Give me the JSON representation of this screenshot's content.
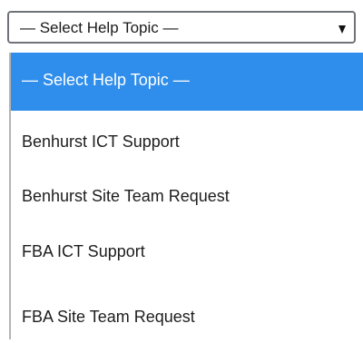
{
  "select": {
    "value": "— Select Help Topic —",
    "arrow_icon": "triangle-down-icon"
  },
  "dropdown": {
    "options": [
      {
        "label": "— Select Help Topic —",
        "highlighted": true
      },
      {
        "label": "Benhurst ICT Support",
        "highlighted": false
      },
      {
        "label": "Benhurst Site Team Request",
        "highlighted": false
      },
      {
        "label": "FBA ICT Support",
        "highlighted": false
      },
      {
        "label": "FBA Site Team Request",
        "highlighted": false
      }
    ]
  },
  "colors": {
    "highlight": "#2f8eeb",
    "text": "#1d1d1d",
    "border": "#6f7378"
  }
}
